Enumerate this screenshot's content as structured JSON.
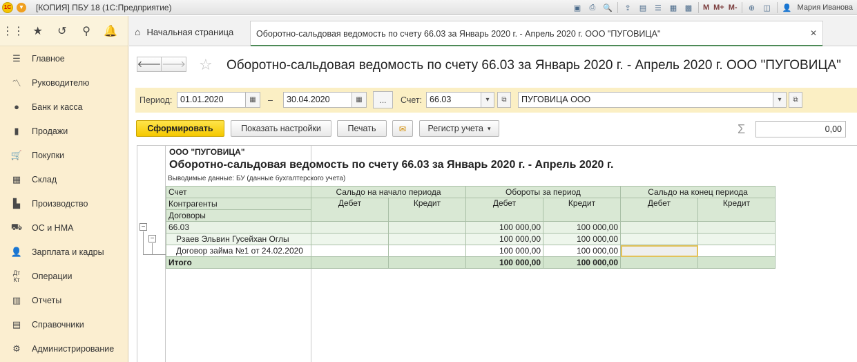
{
  "titlebar": {
    "title": "[КОПИЯ] ПБУ 18  (1С:Предприятие)",
    "logo": "1С",
    "m": "M",
    "m_plus": "M+",
    "m_minus": "M-",
    "user": "Мария Иванова"
  },
  "sidebar": {
    "items": [
      {
        "label": "Главное",
        "icon": "menu-icon"
      },
      {
        "label": "Руководителю",
        "icon": "trend-icon"
      },
      {
        "label": "Банк и касса",
        "icon": "coin-icon"
      },
      {
        "label": "Продажи",
        "icon": "bag-icon"
      },
      {
        "label": "Покупки",
        "icon": "cart-icon"
      },
      {
        "label": "Склад",
        "icon": "warehouse-icon"
      },
      {
        "label": "Производство",
        "icon": "factory-icon"
      },
      {
        "label": "ОС и НМА",
        "icon": "truck-icon"
      },
      {
        "label": "Зарплата и кадры",
        "icon": "person-icon"
      },
      {
        "label": "Операции",
        "icon": "dt-kt-icon"
      },
      {
        "label": "Отчеты",
        "icon": "bar-chart-icon"
      },
      {
        "label": "Справочники",
        "icon": "book-icon"
      },
      {
        "label": "Администрирование",
        "icon": "gear-icon"
      }
    ]
  },
  "tabs": {
    "home": "Начальная страница",
    "active": "Оборотно-сальдовая ведомость по счету 66.03 за Январь 2020 г. - Апрель 2020 г. ООО \"ПУГОВИЦА\""
  },
  "header": {
    "title": "Оборотно-сальдовая ведомость по счету 66.03 за Январь 2020 г. - Апрель 2020 г. ООО \"ПУГОВИЦА\""
  },
  "filters": {
    "period_label": "Период:",
    "date_from": "01.01.2020",
    "dash": "–",
    "date_to": "30.04.2020",
    "dots": "...",
    "account_label": "Счет:",
    "account": "66.03",
    "organization": "ПУГОВИЦА ООО"
  },
  "toolbar": {
    "generate": "Сформировать",
    "show_settings": "Показать настройки",
    "print": "Печать",
    "register": "Регистр учета",
    "sigma": "Σ",
    "sum": "0,00"
  },
  "report": {
    "org": "ООО \"ПУГОВИЦА\"",
    "title": "Оборотно-сальдовая ведомость по счету 66.03 за Январь 2020 г. - Апрель 2020 г.",
    "shown": "Выводимые данные:  БУ (данные бухгалтерского учета)",
    "headers": {
      "account": "Счет",
      "counterparties": "Контрагенты",
      "contracts": "Договоры",
      "opening": "Сальдо на начало периода",
      "turnover": "Обороты за период",
      "closing": "Сальдо на конец периода",
      "debit": "Дебет",
      "credit": "Кредит"
    },
    "rows": [
      {
        "name": "66.03",
        "open_d": "",
        "open_c": "",
        "turn_d": "100 000,00",
        "turn_c": "100 000,00",
        "close_d": "",
        "close_c": ""
      },
      {
        "name": "Рзаев Эльвин Гусейхан Оглы",
        "open_d": "",
        "open_c": "",
        "turn_d": "100 000,00",
        "turn_c": "100 000,00",
        "close_d": "",
        "close_c": ""
      },
      {
        "name": "Договор займа №1 от 24.02.2020",
        "open_d": "",
        "open_c": "",
        "turn_d": "100 000,00",
        "turn_c": "100 000,00",
        "close_d": "",
        "close_c": ""
      }
    ],
    "total": {
      "name": "Итого",
      "turn_d": "100 000,00",
      "turn_c": "100 000,00"
    }
  }
}
